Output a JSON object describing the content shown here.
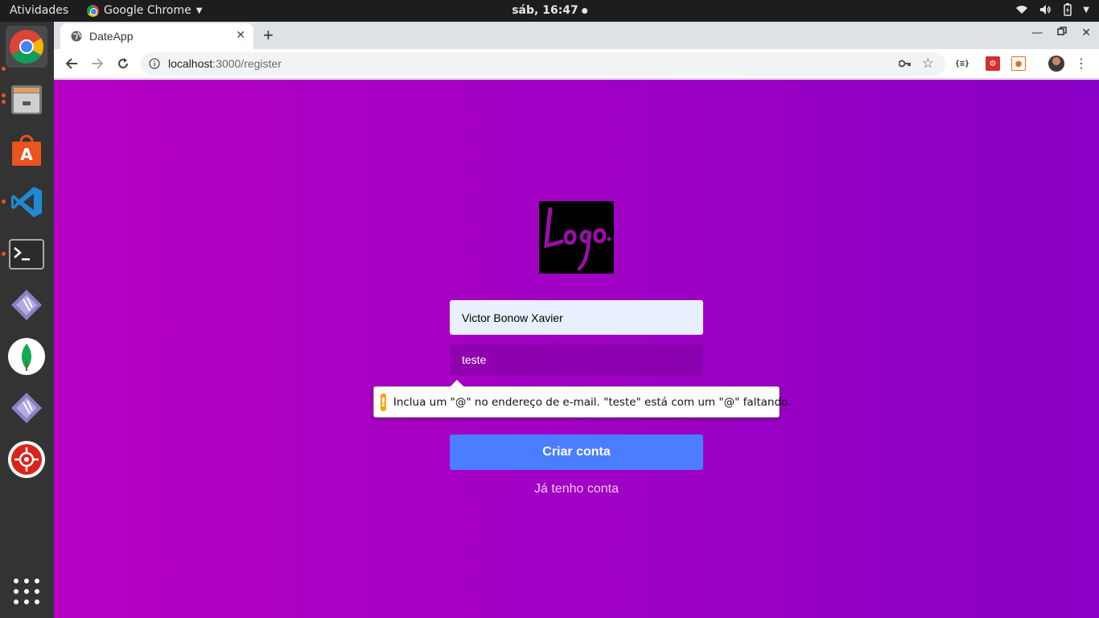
{
  "topbar": {
    "activities": "Atividades",
    "app_name": "Google Chrome",
    "clock": "sáb, 16:47"
  },
  "dock": {
    "items": [
      "chrome-icon",
      "files-icon",
      "software-center-icon",
      "vscode-icon",
      "terminal-icon",
      "git-kraken-icon",
      "mongodb-compass-icon",
      "git-kraken-icon",
      "insomnia-icon"
    ]
  },
  "browser": {
    "tab_title": "DateApp",
    "url_host": "localhost",
    "url_path": ":3000/register"
  },
  "form": {
    "name_value": "Victor Bonow Xavier",
    "email_value": "teste",
    "submit_label": "Criar conta",
    "login_link": "Já tenho conta"
  },
  "validation": {
    "message": "Inclua um \"@\" no endereço de e-mail. \"teste\" está com um \"@\" faltando."
  },
  "colors": {
    "page_gradient_start": "#b500c2",
    "page_gradient_end": "#8a00c6",
    "button": "#4a7dff",
    "warning": "#f7a600"
  }
}
